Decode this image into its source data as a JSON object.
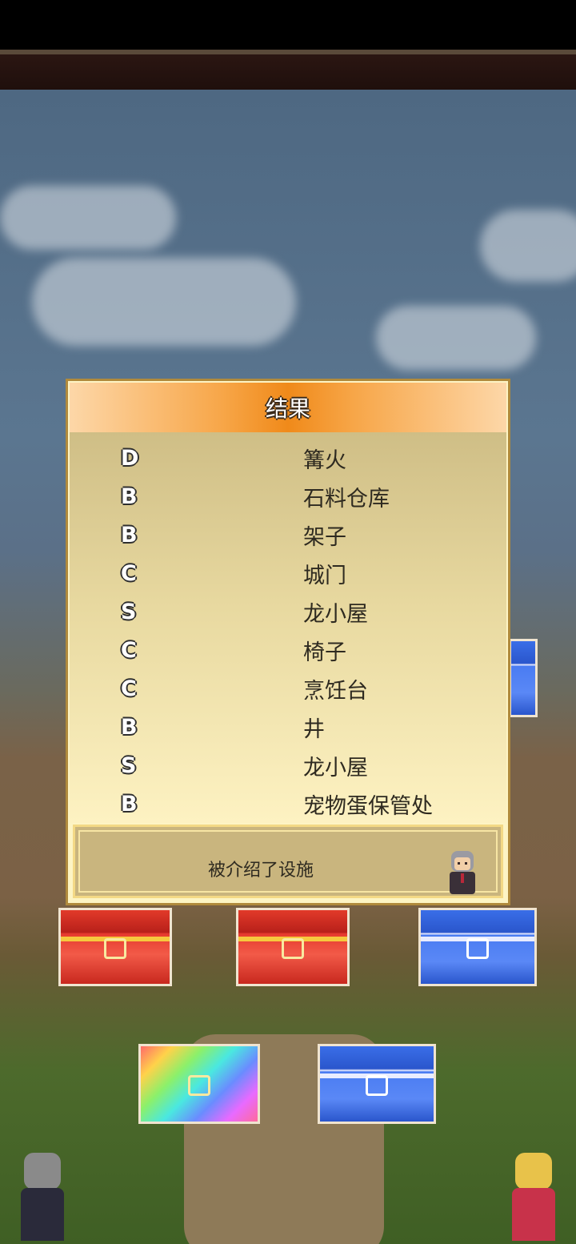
{
  "dialog": {
    "title": "结果",
    "results": [
      {
        "rank": "D",
        "facility": "篝火"
      },
      {
        "rank": "B",
        "facility": "石料仓库"
      },
      {
        "rank": "B",
        "facility": "架子"
      },
      {
        "rank": "C",
        "facility": "城门"
      },
      {
        "rank": "S",
        "facility": "龙小屋"
      },
      {
        "rank": "C",
        "facility": "椅子"
      },
      {
        "rank": "C",
        "facility": "烹饪台"
      },
      {
        "rank": "B",
        "facility": "井"
      },
      {
        "rank": "S",
        "facility": "龙小屋"
      },
      {
        "rank": "B",
        "facility": "宠物蛋保管处"
      }
    ],
    "message": "被介绍了设施"
  },
  "chests": [
    {
      "kind": "red"
    },
    {
      "kind": "red"
    },
    {
      "kind": "blue"
    },
    {
      "kind": "rainbow"
    },
    {
      "kind": "blue"
    }
  ],
  "colors": {
    "header_orange": "#f08a1a",
    "panel_cream": "#fdf4c4",
    "panel_border": "#b08a3c",
    "red_chest": "#e23a2a",
    "blue_chest": "#3a6ee8"
  }
}
